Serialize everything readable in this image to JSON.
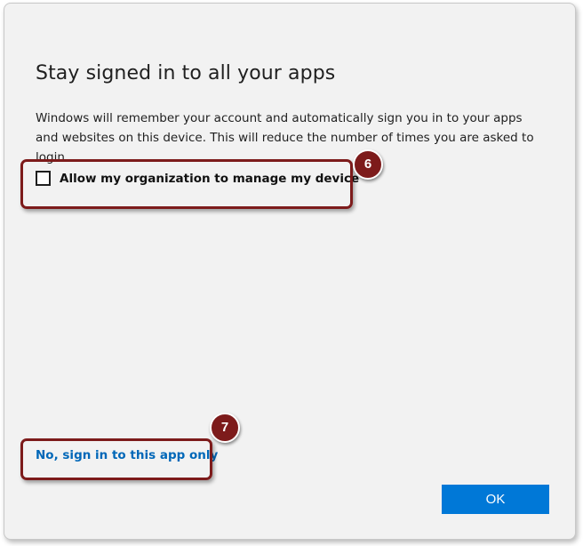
{
  "dialog": {
    "title": "Stay signed in to all your apps",
    "description": "Windows will remember your account and automatically sign you in to your apps and websites on this device. This will reduce the number of times you are asked to login.",
    "checkbox": {
      "label": "Allow my organization to manage my device",
      "checked": false
    },
    "link_label": "No, sign in to this app only",
    "ok_label": "OK"
  },
  "annotations": {
    "step_checkbox": "6",
    "step_link": "7",
    "color": "#7d1b1b"
  },
  "colors": {
    "accent": "#0078d7",
    "link": "#0067b8",
    "background": "#f2f2f2"
  }
}
